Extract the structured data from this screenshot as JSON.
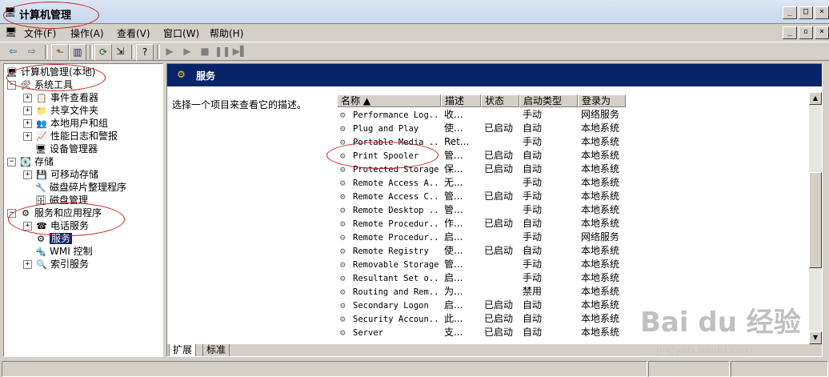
{
  "window": {
    "title": "计算机管理"
  },
  "menus": [
    "文件(F)",
    "操作(A)",
    "查看(V)",
    "窗口(W)",
    "帮助(H)"
  ],
  "tree": {
    "root": "计算机管理(本地)",
    "system_tools": "系统工具",
    "event_viewer": "事件查看器",
    "shared_folders": "共享文件夹",
    "local_users": "本地用户和组",
    "perf_logs": "性能日志和警报",
    "device_manager": "设备管理器",
    "storage": "存储",
    "removable": "可移动存储",
    "defrag": "磁盘碎片整理程序",
    "disk_mgmt": "磁盘管理",
    "services_apps": "服务和应用程序",
    "telephony": "电话服务",
    "services": "服务",
    "wmi": "WMI 控制",
    "indexing": "索引服务"
  },
  "right": {
    "header": "服务",
    "description": "选择一个项目来查看它的描述。",
    "columns": [
      "名称 ▲",
      "描述",
      "状态",
      "启动类型",
      "登录为"
    ],
    "rows": [
      [
        "Performance Log...",
        "收...",
        "",
        "手动",
        "网络服务"
      ],
      [
        "Plug and Play",
        "使...",
        "已启动",
        "自动",
        "本地系统"
      ],
      [
        "Portable Media ...",
        "Ret...",
        "",
        "手动",
        "本地系统"
      ],
      [
        "Print Spooler",
        "管...",
        "已启动",
        "自动",
        "本地系统"
      ],
      [
        "Protected Storage",
        "保...",
        "已启动",
        "自动",
        "本地系统"
      ],
      [
        "Remote Access A...",
        "无...",
        "",
        "手动",
        "本地系统"
      ],
      [
        "Remote Access C...",
        "管...",
        "已启动",
        "手动",
        "本地系统"
      ],
      [
        "Remote Desktop ...",
        "管...",
        "",
        "手动",
        "本地系统"
      ],
      [
        "Remote Procedur...",
        "作...",
        "已启动",
        "自动",
        "本地系统"
      ],
      [
        "Remote Procedur...",
        "启...",
        "",
        "手动",
        "网络服务"
      ],
      [
        "Remote Registry",
        "使...",
        "已启动",
        "自动",
        "本地系统"
      ],
      [
        "Removable Storage",
        "管...",
        "",
        "手动",
        "本地系统"
      ],
      [
        "Resultant Set o...",
        "启...",
        "",
        "手动",
        "本地系统"
      ],
      [
        "Routing and Rem...",
        "为...",
        "",
        "禁用",
        "本地系统"
      ],
      [
        "Secondary Logon",
        "启...",
        "已启动",
        "自动",
        "本地系统"
      ],
      [
        "Security Accoun...",
        "此...",
        "已启动",
        "自动",
        "本地系统"
      ],
      [
        "Server",
        "支...",
        "已启动",
        "自动",
        "本地系统"
      ]
    ],
    "tabs": [
      "扩展",
      "标准"
    ]
  },
  "watermark": {
    "brand": "Bai du 经验",
    "url": "jingyan.baidu.com"
  }
}
